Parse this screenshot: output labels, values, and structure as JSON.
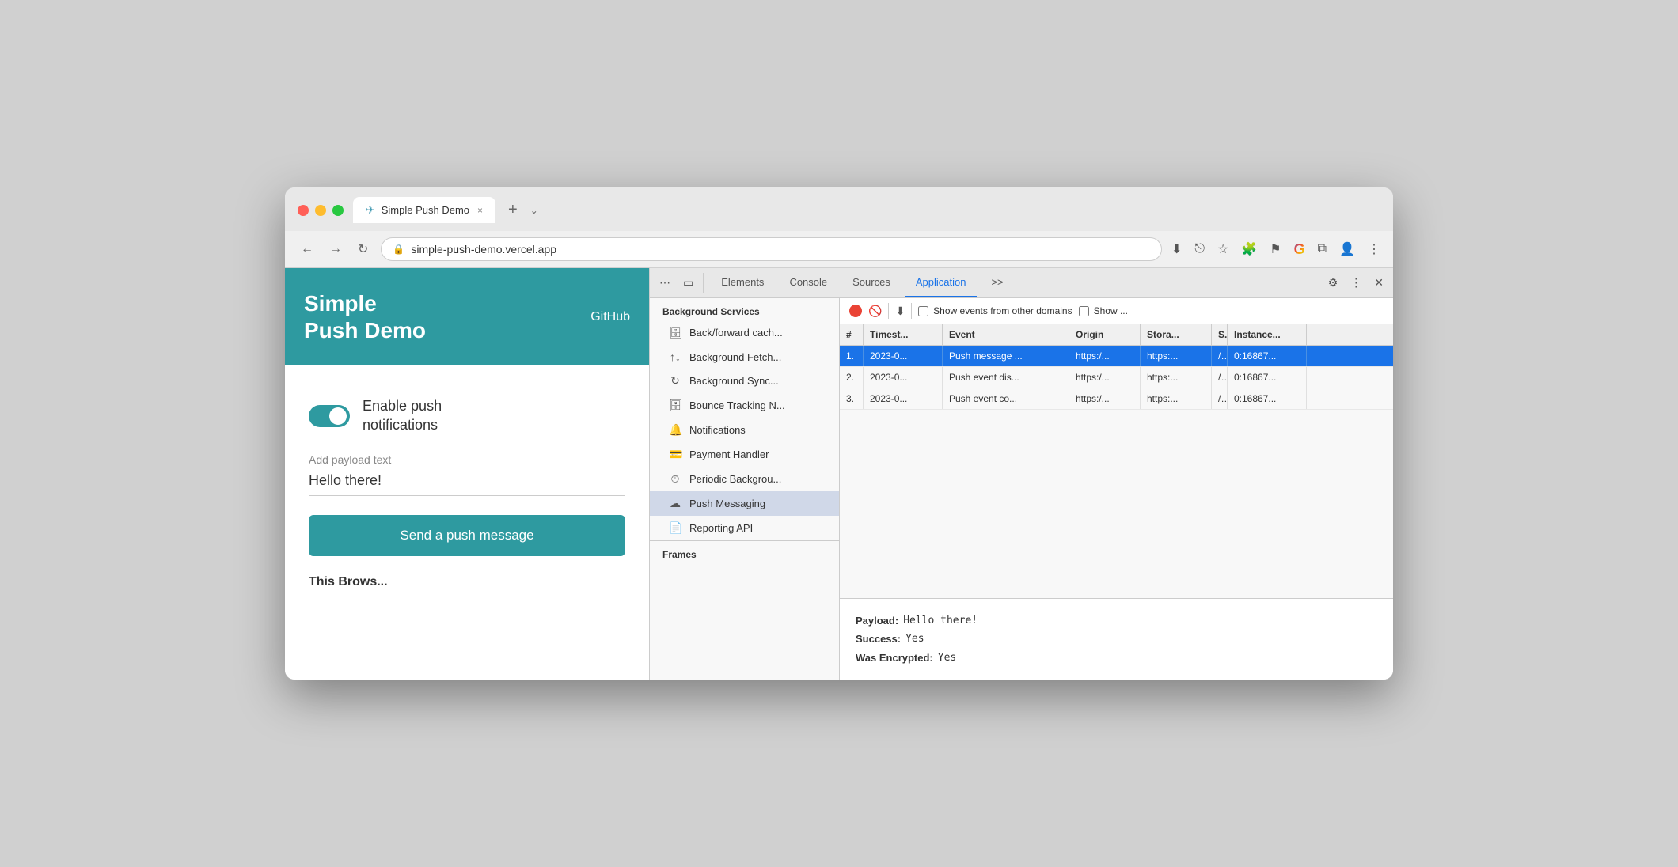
{
  "browser": {
    "tab_title": "Simple Push Demo",
    "tab_close": "×",
    "new_tab": "+",
    "tab_dropdown": "⌄",
    "address": "simple-push-demo.vercel.app",
    "nav_back": "←",
    "nav_forward": "→",
    "nav_refresh": "↻"
  },
  "toolbar_icons": {
    "download": "⬇",
    "share": "⎋",
    "bookmark": "☆",
    "extensions": "🧩",
    "flag": "⚑",
    "google": "G",
    "split": "⧉",
    "account": "👤",
    "menu": "⋮"
  },
  "website": {
    "title_line1": "Simple",
    "title_line2": "Push Demo",
    "github_link": "GitHub",
    "toggle_label_line1": "Enable push",
    "toggle_label_line2": "notifications",
    "payload_label": "Add payload text",
    "payload_value": "Hello there!",
    "send_button": "Send a push message",
    "this_browser": "This Brows..."
  },
  "devtools": {
    "tabs": [
      "Elements",
      "Console",
      "Sources",
      "Application"
    ],
    "active_tab": "Application",
    "more_tabs": ">>",
    "sidebar_title": "Background Services",
    "sidebar_items": [
      {
        "icon": "🗄",
        "label": "Back/forward cach..."
      },
      {
        "icon": "↑↓",
        "label": "Background Fetch..."
      },
      {
        "icon": "↻",
        "label": "Background Sync..."
      },
      {
        "icon": "🗄",
        "label": "Bounce Tracking N..."
      },
      {
        "icon": "🔔",
        "label": "Notifications"
      },
      {
        "icon": "💳",
        "label": "Payment Handler"
      },
      {
        "icon": "⏱",
        "label": "Periodic Backgrou..."
      },
      {
        "icon": "☁",
        "label": "Push Messaging"
      },
      {
        "icon": "📄",
        "label": "Reporting API"
      }
    ],
    "frames_label": "Frames",
    "toolbar": {
      "record_title": "Record",
      "clear_title": "Clear",
      "download_title": "Download",
      "checkbox_label": "Show events from other domains",
      "checkbox2_label": "Show ..."
    },
    "table": {
      "headers": [
        "#",
        "Timest...",
        "Event",
        "Origin",
        "Stora...",
        "S...",
        "Instance..."
      ],
      "rows": [
        {
          "num": "1.",
          "timestamp": "2023-0...",
          "event": "Push message ...",
          "origin": "https:/...",
          "storage": "https:...",
          "slash": "/",
          "instance": "0:16867...",
          "highlighted": true
        },
        {
          "num": "2.",
          "timestamp": "2023-0...",
          "event": "Push event dis...",
          "origin": "https:/...",
          "storage": "https:...",
          "slash": "/",
          "instance": "0:16867..."
        },
        {
          "num": "3.",
          "timestamp": "2023-0...",
          "event": "Push event co...",
          "origin": "https:/...",
          "storage": "https:...",
          "slash": "/",
          "instance": "0:16867..."
        }
      ]
    },
    "detail": {
      "payload_key": "Payload:",
      "payload_value": "Hello there!",
      "success_key": "Success:",
      "success_value": "Yes",
      "encrypted_key": "Was Encrypted:",
      "encrypted_value": "Yes"
    }
  },
  "colors": {
    "teal": "#2e9aa0",
    "blue_highlight": "#1a73e8",
    "red": "#ea4335"
  }
}
